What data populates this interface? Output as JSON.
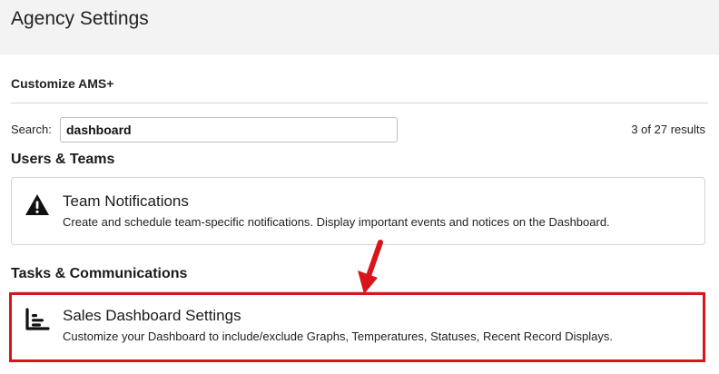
{
  "header": {
    "title": "Agency Settings"
  },
  "section": {
    "title": "Customize AMS+"
  },
  "search": {
    "label": "Search:",
    "value": "dashboard",
    "results": "3 of 27 results"
  },
  "groups": [
    {
      "heading": "Users & Teams",
      "items": [
        {
          "icon": "warning-icon",
          "title": "Team Notifications",
          "description": "Create and schedule team-specific notifications. Display important events and notices on the Dashboard."
        }
      ]
    },
    {
      "heading": "Tasks & Communications",
      "items": [
        {
          "icon": "bar-chart-icon",
          "title": "Sales Dashboard Settings",
          "description": "Customize your Dashboard to include/exclude Graphs, Temperatures, Statuses, Recent Record Displays."
        }
      ]
    }
  ],
  "annotation": {
    "color": "#d9151b"
  },
  "colors": {
    "header_bg": "#f3f3f3",
    "border": "#d4d4d4"
  }
}
